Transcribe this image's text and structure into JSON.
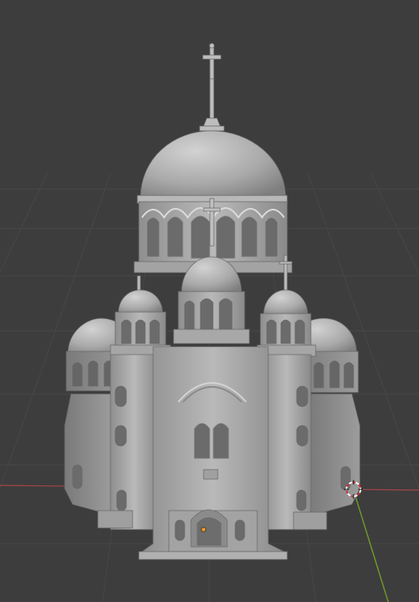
{
  "viewport": {
    "background": "#3d3d3d",
    "grid_color": "#484848",
    "x_axis_color": "#b04a4a",
    "y_axis_color": "#6f9a2a",
    "model_color": "#b5b5b5",
    "origin_color": "#e8942c",
    "model": "cathedral-3d-model",
    "cursor_icon": "3d-cursor-icon"
  }
}
